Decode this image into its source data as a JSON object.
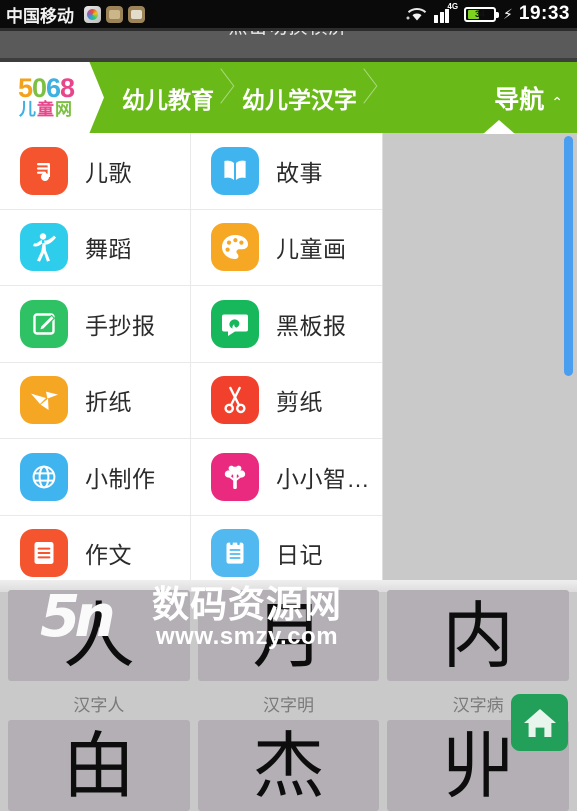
{
  "statusbar": {
    "carrier": "中国移动",
    "notification_icons": [
      "gallery-icon",
      "app-icon",
      "image-icon"
    ],
    "wifi": "wifi-icon",
    "network_type": "4G",
    "signal": "signal-bars-icon",
    "battery_percent": "34",
    "charging": "⚡",
    "clock": "19:33"
  },
  "rotate_hint": {
    "text": "点击切换横屏"
  },
  "navbar": {
    "logo": {
      "top": [
        "5",
        "0",
        "6",
        "8"
      ],
      "bottom": [
        "儿",
        "童",
        "网"
      ]
    },
    "breadcrumbs": [
      {
        "label": "幼儿教育"
      },
      {
        "label": "幼儿学汉字"
      }
    ],
    "nav_button": {
      "label": "导航",
      "caret": "⌃"
    },
    "accent_color": "#69ba18"
  },
  "dropdown": {
    "items": [
      {
        "label": "儿歌",
        "icon": "music-note-icon",
        "color": "#f4542e"
      },
      {
        "label": "故事",
        "icon": "open-book-icon",
        "color": "#3fb4ef"
      },
      {
        "label": "舞蹈",
        "icon": "dancer-icon",
        "color": "#2ecdec"
      },
      {
        "label": "儿童画",
        "icon": "palette-icon",
        "color": "#f6a724"
      },
      {
        "label": "手抄报",
        "icon": "pencil-note-icon",
        "color": "#2ec264"
      },
      {
        "label": "黑板报",
        "icon": "chalkboard-icon",
        "color": "#17b85c"
      },
      {
        "label": "折纸",
        "icon": "paper-crane-icon",
        "color": "#f5a623"
      },
      {
        "label": "剪纸",
        "icon": "scissors-icon",
        "color": "#f1402c"
      },
      {
        "label": "小制作",
        "icon": "globe-icon",
        "color": "#3fb4ef"
      },
      {
        "label": "小小智…",
        "icon": "tree-icon",
        "color": "#ea2a7e"
      },
      {
        "label": "作文",
        "icon": "document-icon",
        "color": "#f4542e"
      },
      {
        "label": "日记",
        "icon": "notepad-icon",
        "color": "#51b9ef"
      }
    ]
  },
  "scrollbar": {
    "name": "vertical-scrollbar",
    "color": "#4a9ef0"
  },
  "page_content": {
    "rows": [
      [
        {
          "caption": "汉字人",
          "glyph": "人"
        },
        {
          "caption": "汉字明",
          "glyph": "月"
        },
        {
          "caption": "汉字病",
          "glyph": "内"
        }
      ],
      [
        {
          "caption": "",
          "glyph": "甶"
        },
        {
          "caption": "",
          "glyph": "杰"
        },
        {
          "caption": "",
          "glyph": "丱"
        }
      ]
    ]
  },
  "watermark": {
    "mark": "5n",
    "site_cn": "数码资源网",
    "url": "www.smzy.com"
  },
  "home_fab": {
    "icon": "home-icon",
    "color": "#22a05a"
  }
}
